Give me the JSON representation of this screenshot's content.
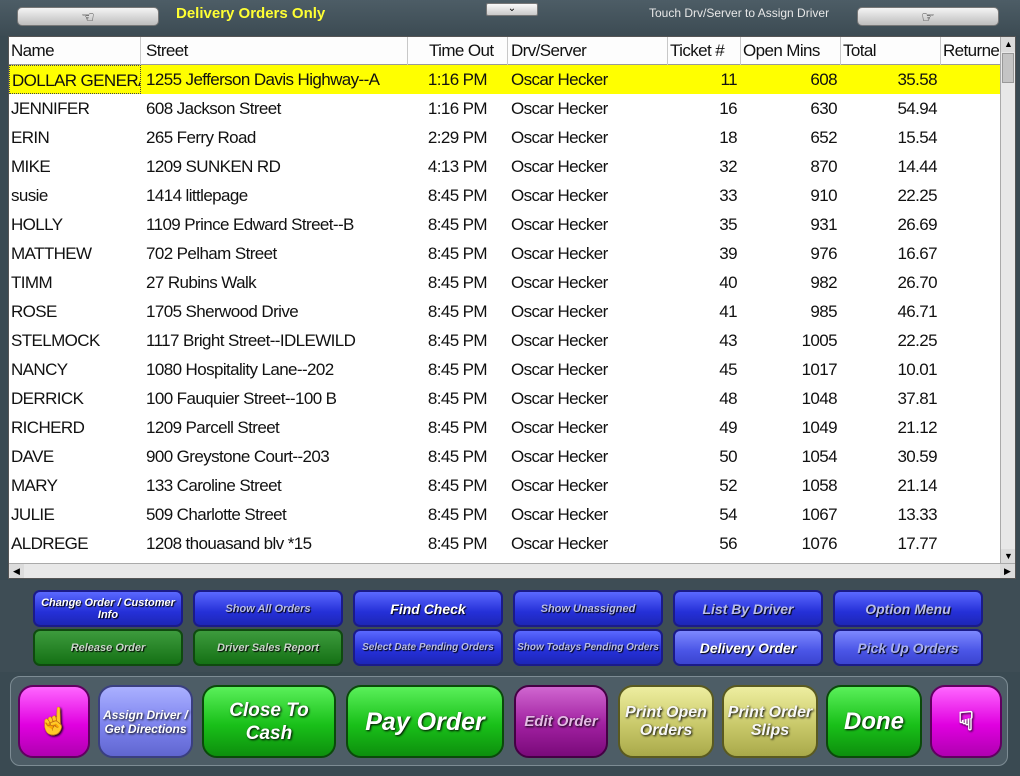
{
  "top": {
    "left_hand": "☜",
    "title": "Delivery Orders Only",
    "collapse_glyph": "⌄",
    "hint": "Touch Drv/Server to Assign Driver",
    "right_hand": "☞"
  },
  "table": {
    "headers": [
      "Name",
      "Street",
      "Time Out",
      "Drv/Server",
      "Ticket #",
      "Open Mins",
      "Total",
      "Returned"
    ],
    "rows": [
      {
        "name": "DOLLAR GENERAL",
        "street": "1255 Jefferson Davis Highway--A",
        "time": "1:16 PM",
        "driver": "Oscar Hecker",
        "ticket": "11",
        "open": "608",
        "total": "35.58",
        "selected": true
      },
      {
        "name": "JENNIFER",
        "street": "608 Jackson Street",
        "time": "1:16 PM",
        "driver": "Oscar Hecker",
        "ticket": "16",
        "open": "630",
        "total": "54.94"
      },
      {
        "name": "ERIN",
        "street": "265 Ferry Road",
        "time": "2:29 PM",
        "driver": "Oscar Hecker",
        "ticket": "18",
        "open": "652",
        "total": "15.54"
      },
      {
        "name": "MIKE",
        "street": "1209 SUNKEN RD",
        "time": "4:13 PM",
        "driver": "Oscar Hecker",
        "ticket": "32",
        "open": "870",
        "total": "14.44"
      },
      {
        "name": "susie",
        "street": "1414 littlepage",
        "time": "8:45 PM",
        "driver": "Oscar Hecker",
        "ticket": "33",
        "open": "910",
        "total": "22.25"
      },
      {
        "name": "HOLLY",
        "street": "1109 Prince Edward Street--B",
        "time": "8:45 PM",
        "driver": "Oscar Hecker",
        "ticket": "35",
        "open": "931",
        "total": "26.69"
      },
      {
        "name": "MATTHEW",
        "street": "702 Pelham Street",
        "time": "8:45 PM",
        "driver": "Oscar Hecker",
        "ticket": "39",
        "open": "976",
        "total": "16.67"
      },
      {
        "name": "TIMM",
        "street": "27 Rubins Walk",
        "time": "8:45 PM",
        "driver": "Oscar Hecker",
        "ticket": "40",
        "open": "982",
        "total": "26.70"
      },
      {
        "name": "ROSE",
        "street": "1705 Sherwood Drive",
        "time": "8:45 PM",
        "driver": "Oscar Hecker",
        "ticket": "41",
        "open": "985",
        "total": "46.71"
      },
      {
        "name": "STELMOCK",
        "street": "1117 Bright Street--IDLEWILD",
        "time": "8:45 PM",
        "driver": "Oscar Hecker",
        "ticket": "43",
        "open": "1005",
        "total": "22.25"
      },
      {
        "name": "NANCY",
        "street": "1080 Hospitality Lane--202",
        "time": "8:45 PM",
        "driver": "Oscar Hecker",
        "ticket": "45",
        "open": "1017",
        "total": "10.01"
      },
      {
        "name": "DERRICK",
        "street": "100 Fauquier Street--100 B",
        "time": "8:45 PM",
        "driver": "Oscar Hecker",
        "ticket": "48",
        "open": "1048",
        "total": "37.81"
      },
      {
        "name": "RICHERD",
        "street": "1209 Parcell Street",
        "time": "8:45 PM",
        "driver": "Oscar Hecker",
        "ticket": "49",
        "open": "1049",
        "total": "21.12"
      },
      {
        "name": "DAVE",
        "street": "900 Greystone Court--203",
        "time": "8:45 PM",
        "driver": "Oscar Hecker",
        "ticket": "50",
        "open": "1054",
        "total": "30.59"
      },
      {
        "name": "MARY",
        "street": "133 Caroline Street",
        "time": "8:45 PM",
        "driver": "Oscar Hecker",
        "ticket": "52",
        "open": "1058",
        "total": "21.14"
      },
      {
        "name": "JULIE",
        "street": "509 Charlotte Street",
        "time": "8:45 PM",
        "driver": "Oscar Hecker",
        "ticket": "54",
        "open": "1067",
        "total": "13.33"
      },
      {
        "name": "ALDREGE",
        "street": "1208 thouasand blv *15",
        "time": "8:45 PM",
        "driver": "Oscar Hecker",
        "ticket": "56",
        "open": "1076",
        "total": "17.77"
      }
    ],
    "scroll_up": "▲",
    "scroll_down": "▼",
    "scroll_left": "◀",
    "scroll_right": "▶"
  },
  "panel": {
    "change_order": "Change Order / Customer Info",
    "show_all": "Show All Orders",
    "find_check": "Find Check",
    "show_unassigned": "Show Unassigned",
    "list_by_driver": "List By Driver",
    "option_menu": "Option Menu",
    "release_order": "Release Order",
    "driver_sales": "Driver Sales Report",
    "select_date": "Select Date Pending Orders",
    "show_todays": "Show Todays Pending Orders",
    "delivery_order": "Delivery Order",
    "pick_up": "Pick Up Orders"
  },
  "bottom": {
    "left_hand": "☝",
    "assign_driver": "Assign Driver / Get Directions",
    "close_to_cash": "Close To Cash",
    "pay_order": "Pay Order",
    "edit_order": "Edit Order",
    "print_open": "Print Open Orders",
    "print_slips": "Print Order Slips",
    "done": "Done",
    "right_hand": "☟"
  }
}
